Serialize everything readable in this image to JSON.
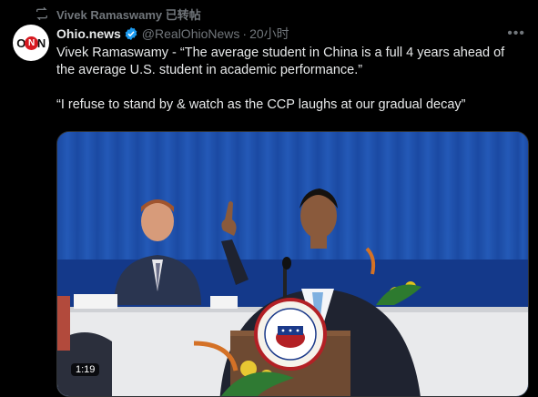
{
  "repost": {
    "icon": "repost-icon",
    "label": "Vivek Ramaswamy 已转帖"
  },
  "author": {
    "avatar_text": [
      "O",
      "N",
      "N"
    ],
    "name": "Ohio.news",
    "verified_icon": "verified-badge-icon",
    "verified_color": "#1d9bf0",
    "handle": "@RealOhioNews",
    "separator": "·",
    "time": "20小时",
    "more_icon": "more-options-icon"
  },
  "tweet": {
    "paragraph1": "Vivek Ramaswamy - “The average student in China is a full 4 years ahead of the average U.S. student in academic performance.”",
    "paragraph2": "“I refuse to stand by & watch as the CCP laughs at our gradual decay”"
  },
  "media": {
    "type": "video",
    "duration": "1:19",
    "backdrop_color": "#1d4fa7"
  }
}
